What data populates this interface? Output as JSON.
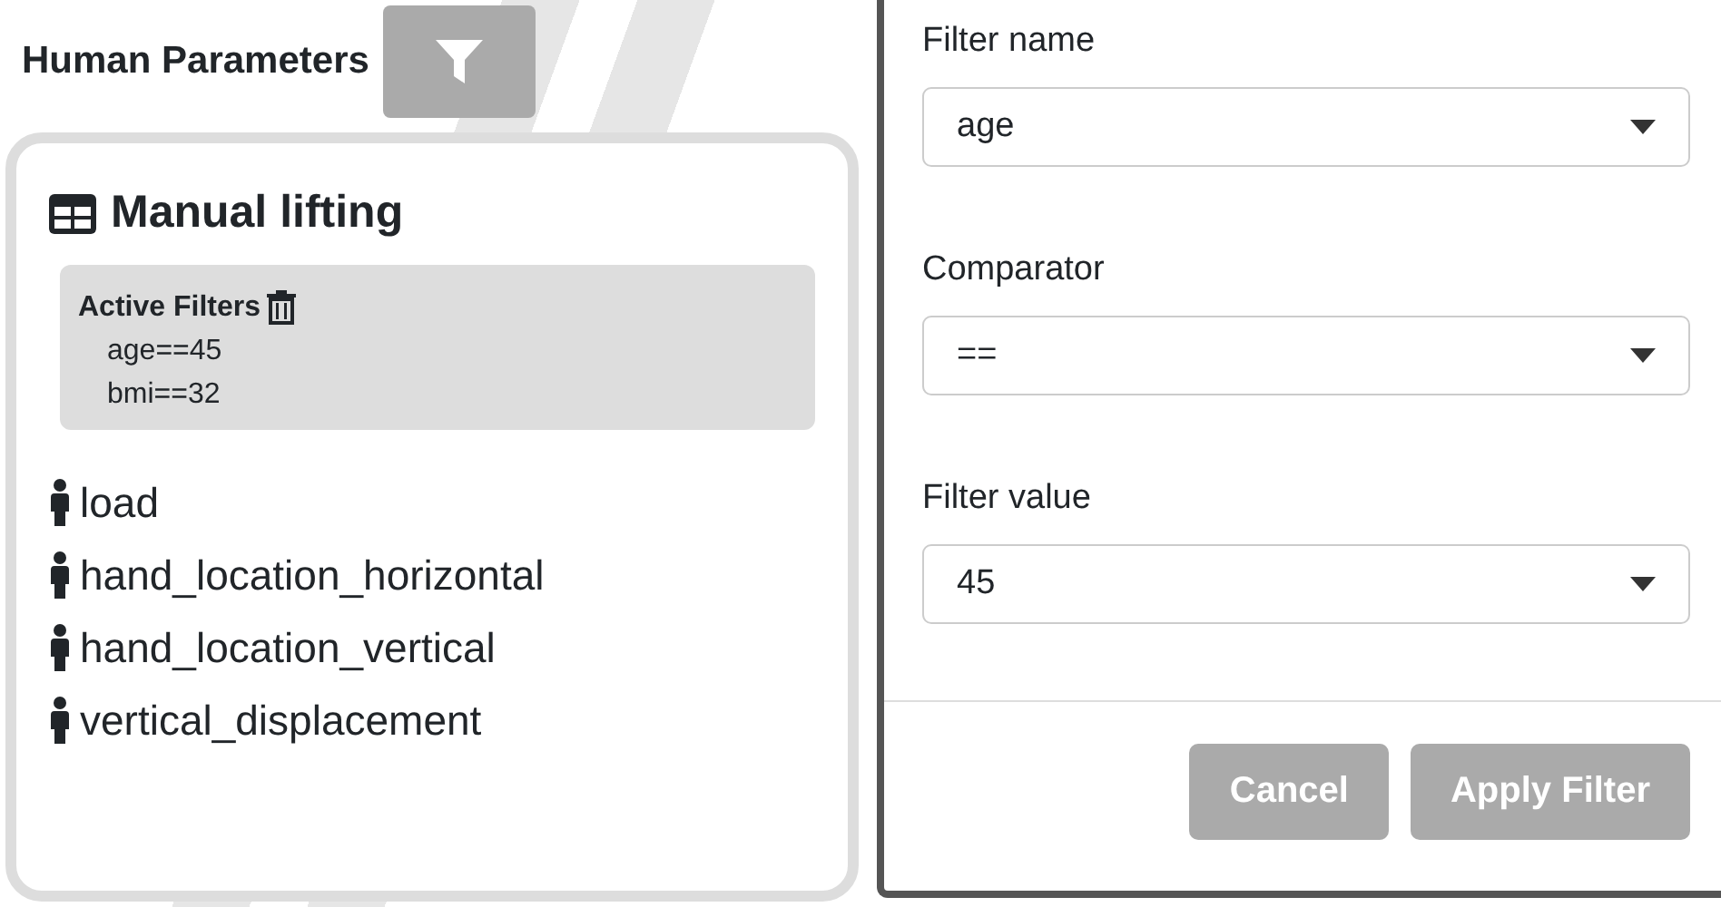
{
  "header": {
    "title": "Human Parameters"
  },
  "card": {
    "title": "Manual lifting",
    "active_filters": {
      "title": "Active Filters",
      "items": [
        "age==45",
        "bmi==32"
      ]
    },
    "parameters": [
      "load",
      "hand_location_horizontal",
      "hand_location_vertical",
      "vertical_displacement"
    ]
  },
  "dialog": {
    "fields": [
      {
        "label": "Filter name",
        "value": "age"
      },
      {
        "label": "Comparator",
        "value": "=="
      },
      {
        "label": "Filter value",
        "value": "45"
      }
    ],
    "buttons": [
      {
        "label": "Cancel"
      },
      {
        "label": "Apply Filter"
      }
    ]
  }
}
